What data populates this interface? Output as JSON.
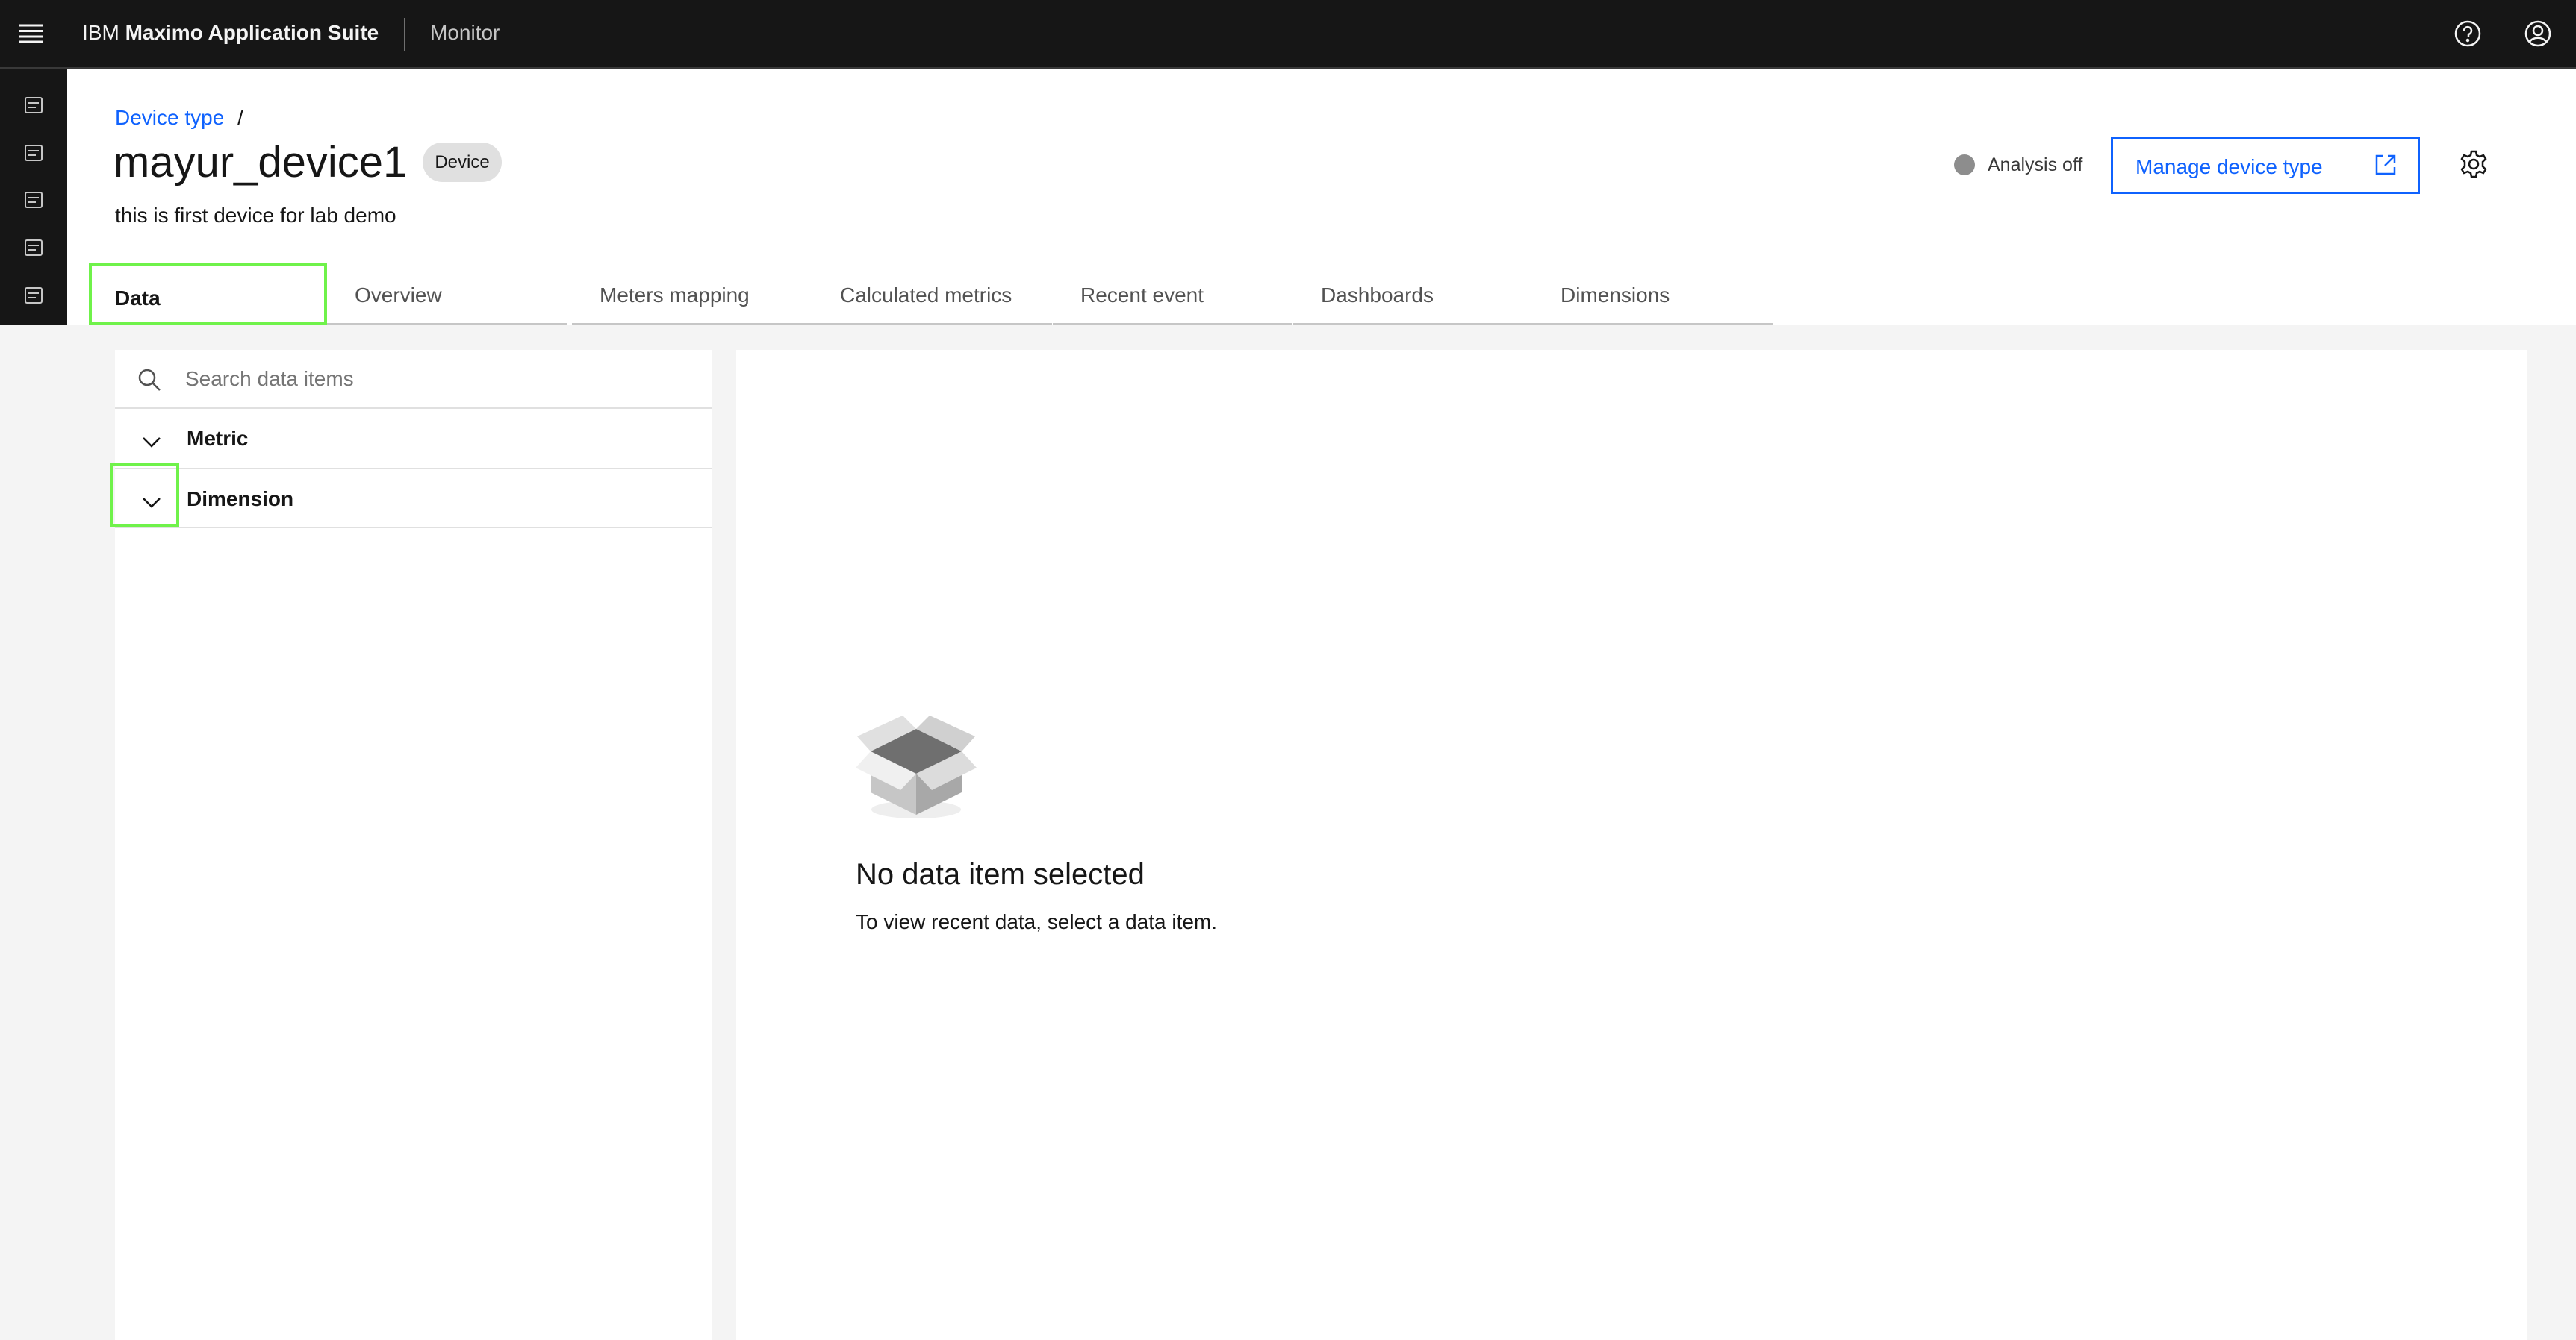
{
  "header": {
    "brand_prefix": "IBM",
    "brand_name": "Maximo Application Suite",
    "app": "Monitor"
  },
  "sidebar": {
    "icons": [
      "asset-icon",
      "model-icon",
      "inventory-icon",
      "hierarchy-icon",
      "calendar-icon",
      "shield-icon",
      "receipt-icon",
      "lock-folder-icon",
      "lock-icon",
      "cart-icon",
      "service-icon",
      "people-icon",
      "sliders-icon",
      "clipboard-check-icon",
      "clipboard-icon",
      "checklist-icon",
      "gauge-icon",
      "network-icon",
      "dashboard-icon",
      "device-type-icon",
      "connect-icon",
      "device-settings-icon",
      "settings-icon"
    ],
    "active": "device-type-icon"
  },
  "breadcrumb": {
    "link": "Device type",
    "sep": "/"
  },
  "page": {
    "title": "mayur_device1",
    "tag": "Device",
    "description": "this is first device for lab demo"
  },
  "actions": {
    "analysis_status": "Analysis off",
    "manage_label": "Manage device type"
  },
  "tabs": [
    {
      "label": "Data",
      "selected": true
    },
    {
      "label": "Overview"
    },
    {
      "label": "Meters mapping"
    },
    {
      "label": "Calculated metrics"
    },
    {
      "label": "Recent event"
    },
    {
      "label": "Dashboards"
    },
    {
      "label": "Dimensions"
    }
  ],
  "data_panel": {
    "search_placeholder": "Search data items",
    "groups": [
      {
        "label": "Metric"
      },
      {
        "label": "Dimension"
      }
    ]
  },
  "empty_state": {
    "title": "No data item selected",
    "message": "To view recent data, select a data item."
  },
  "colors": {
    "link": "#0f62fe",
    "highlight": "#6ff24a",
    "status_off": "#8d8d8d"
  }
}
